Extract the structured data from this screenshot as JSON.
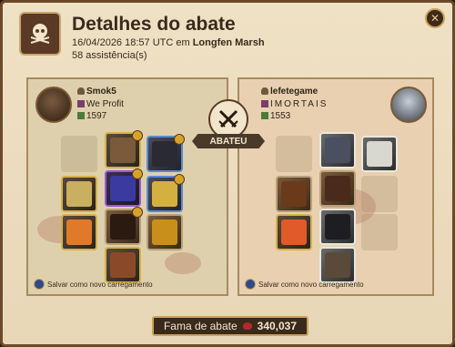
{
  "header": {
    "title": "Detalhes do abate",
    "datetime": "16/04/2026 18:57 UTC em",
    "location": "Longfen Marsh",
    "assists": "58 assistência(s)"
  },
  "killer": {
    "name": "Smok5",
    "guild": "We Profit",
    "item_power": "1597",
    "save_label": "Salvar como novo carregamento"
  },
  "victim": {
    "name": "lefetegame",
    "guild": "IMORTAIS",
    "item_power": "1553",
    "save_label": "Salvar como novo carregamento"
  },
  "versus": {
    "label": "ABATEU"
  },
  "fame": {
    "label": "Fama de abate",
    "value": "340,037"
  },
  "colors": {
    "gold_tier": "#d6b04a",
    "blue_tier": "#5a8ad0",
    "purple_tier": "#9a5ad0",
    "fame_icon": "#b02a2a"
  }
}
